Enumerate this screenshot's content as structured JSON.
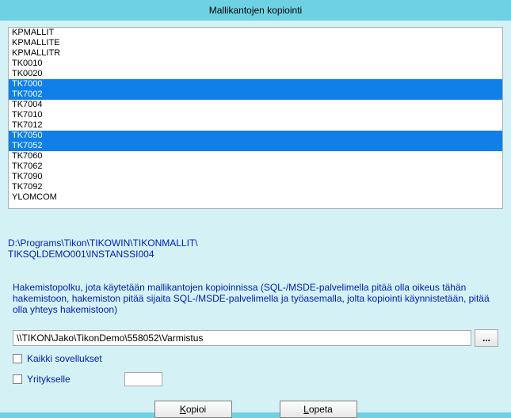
{
  "window": {
    "title": "Mallikantojen kopiointi"
  },
  "listbox": {
    "items": [
      {
        "label": "KPMALLIT",
        "selected": false
      },
      {
        "label": "KPMALLITE",
        "selected": false
      },
      {
        "label": "KPMALLITR",
        "selected": false
      },
      {
        "label": "TK0010",
        "selected": false
      },
      {
        "label": "TK0020",
        "selected": false
      },
      {
        "label": "TK7000",
        "selected": true
      },
      {
        "label": "TK7002",
        "selected": true
      },
      {
        "label": "TK7004",
        "selected": false
      },
      {
        "label": "TK7010",
        "selected": false
      },
      {
        "label": "TK7012",
        "selected": false
      },
      {
        "label": "TK7050",
        "selected": true
      },
      {
        "label": "TK7052",
        "selected": true
      },
      {
        "label": "TK7060",
        "selected": false
      },
      {
        "label": "TK7062",
        "selected": false
      },
      {
        "label": "TK7090",
        "selected": false
      },
      {
        "label": "TK7092",
        "selected": false
      },
      {
        "label": "YLOMCOM",
        "selected": false
      }
    ]
  },
  "paths": {
    "line1": "D:\\Programs\\Tikon\\TIKOWIN\\TIKONMALLIT\\",
    "line2": "TIKSQLDEMO001\\INSTANSSI004"
  },
  "help_text": "Hakemistopolku, jota käytetään mallikantojen kopioinnissa (SQL-/MSDE-palvelimella pitää olla oikeus tähän hakemistoon, hakemiston pitää sijaita SQL-/MSDE-palvelimella ja työasemalla, jolta kopiointi käynnistetään, pitää olla yhteys hakemistoon)",
  "backup_path": {
    "value": "\\\\TIKON\\Jako\\TikonDemo\\558052\\Varmistus",
    "browse_label": "..."
  },
  "checks": {
    "all_apps_label": "Kaikki sovellukset",
    "yritys_label": "Yritykselle",
    "yritys_value": ""
  },
  "buttons": {
    "kopioi": "Kopioi",
    "lopeta": "Lopeta"
  }
}
